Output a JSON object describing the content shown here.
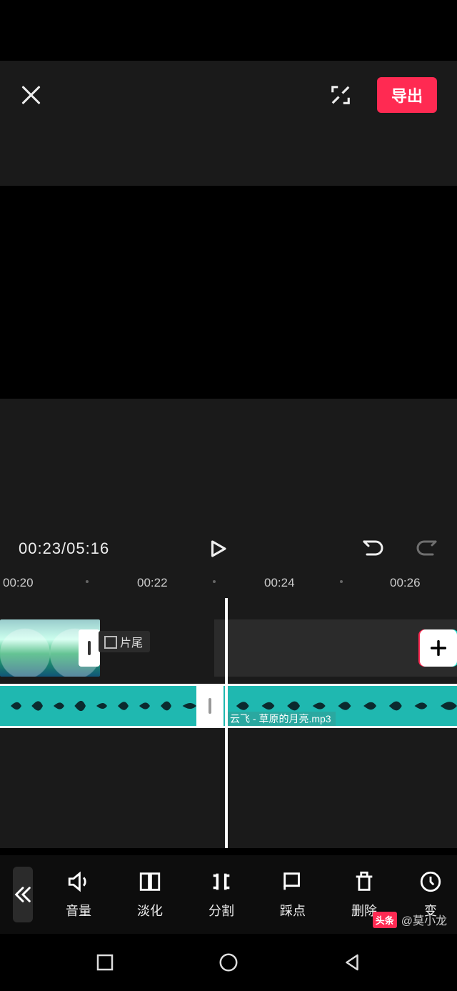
{
  "header": {
    "export_label": "导出"
  },
  "playbar": {
    "time_text": "00:23/05:16"
  },
  "ruler": {
    "ticks": [
      "00:20",
      "00:22",
      "00:24",
      "00:26"
    ]
  },
  "timeline": {
    "tail_label": "片尾",
    "audio_filename": "云飞 - 草原的月亮.mp3"
  },
  "toolbar": {
    "items": [
      {
        "id": "volume",
        "label": "音量"
      },
      {
        "id": "fade",
        "label": "淡化"
      },
      {
        "id": "split",
        "label": "分割"
      },
      {
        "id": "beat",
        "label": "踩点"
      },
      {
        "id": "delete",
        "label": "删除"
      },
      {
        "id": "speed",
        "label": "变"
      }
    ]
  },
  "watermark": {
    "badge": "头条",
    "author": "@莫小龙"
  }
}
